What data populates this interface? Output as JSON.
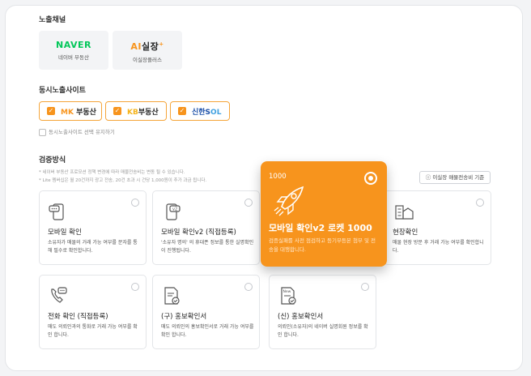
{
  "sections": {
    "exposure_channel": "노출채널",
    "simultaneous_sites": "동시노출사이트",
    "verification_method": "검증방식"
  },
  "channels": [
    {
      "logo": "NAVER",
      "name": "네이버 부동산"
    },
    {
      "logo": "AI실장",
      "name": "이실장플러스"
    }
  ],
  "sites": [
    {
      "label": "MK 부동산",
      "checked": true
    },
    {
      "label": "KB부동산",
      "checked": true
    },
    {
      "label": "신한SOL",
      "checked": true
    }
  ],
  "keep_selection": "동시노출사이트 선택 유지하기",
  "notes": [
    "* 네이버 부동산 프로모션 정책 변경에 따라 매물전송비는 변동 될 수 있습니다.",
    "* Lite 멤버십은 월 20건까지 광고 전송, 20건 초과 시 건당 1,000원이 추가 과금 됩니다."
  ],
  "std_button": "이실장 매물전송비 기준",
  "methods": [
    {
      "title": "모바일 확인",
      "desc": "소유자가 매물의 거래 가능 여부를 문자를 통해 필수로 확인합니다.",
      "icon": "mobile-chat-icon"
    },
    {
      "title": "모바일 확인v2 (직접등록)",
      "desc": "'소유자 명의' 의 휴대폰 정보를 통한 실명확인이 진행됩니다.",
      "icon": "mobile-v2-icon"
    },
    {
      "title": "현장확인",
      "desc": "매물 현장 방문 후 거래 가능 여부를 확인합니다.",
      "icon": "building-icon"
    },
    {
      "title": "전화 확인 (직접등록)",
      "desc": "매도 의뢰인과의 통화로 거래 가능 여부를 확인 합니다.",
      "icon": "phone-icon"
    },
    {
      "title": "(구) 홍보확인서",
      "desc": "매도 의뢰인의 홍보확인서로 거래 가능 여부를 확인 합니다.",
      "icon": "document-check-icon"
    },
    {
      "title": "(신) 홍보확인서",
      "desc": "의뢰인(소유자)의 네이버 실명회원 정보를 확인 합니다.",
      "icon": "new-document-icon"
    }
  ],
  "highlight": {
    "price": "1000",
    "title": "모바일 확인v2 로켓 1000",
    "desc": "검증실패를 사전 점검하고 등기부등본 첨부 및 전송을 대행합니다.",
    "icon": "rocket-icon",
    "selected": true
  },
  "colors": {
    "accent": "#f7941d",
    "naver": "#03c75a"
  }
}
